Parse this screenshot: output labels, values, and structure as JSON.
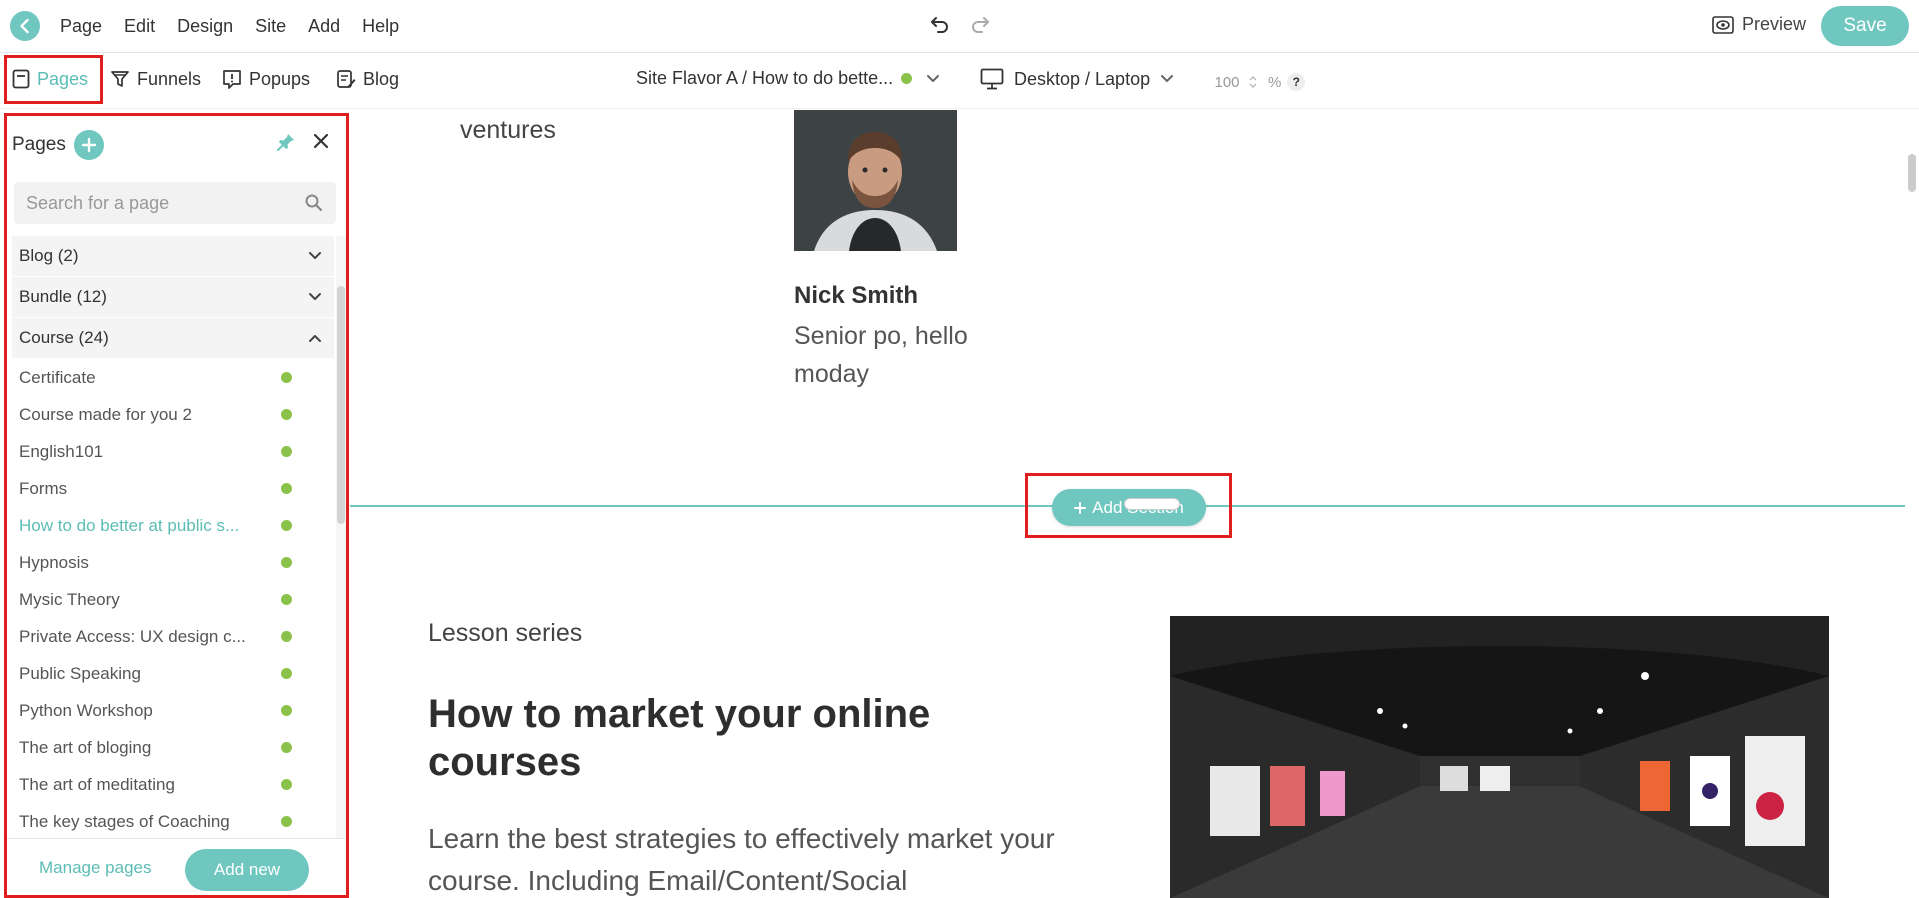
{
  "topbar": {
    "menu": [
      "Page",
      "Edit",
      "Design",
      "Site",
      "Add",
      "Help"
    ],
    "preview_label": "Preview",
    "save_label": "Save"
  },
  "toolbar": {
    "tabs": [
      "Pages",
      "Funnels",
      "Popups",
      "Blog"
    ],
    "flavor_label": "Site Flavor A / How to do bette...",
    "device_label": "Desktop / Laptop",
    "zoom_value": "100",
    "zoom_unit": "%",
    "help_label": "?"
  },
  "panel": {
    "title": "Pages",
    "search_placeholder": "Search for a page",
    "groups": [
      {
        "label": "Blog (2)",
        "expanded": false
      },
      {
        "label": "Bundle (12)",
        "expanded": false
      },
      {
        "label": "Course (24)",
        "expanded": true
      }
    ],
    "pages": [
      "Certificate",
      "Course made for you 2",
      "English101",
      "Forms",
      "How to do better at public s...",
      "Hypnosis",
      "Mysic Theory",
      "Private Access: UX design c...",
      "Public Speaking",
      "Python Workshop",
      "The art of bloging",
      "The art of meditating",
      "The key stages of Coaching"
    ],
    "active_page_index": 4,
    "status_color": "#8bc34a",
    "manage_label": "Manage pages",
    "add_new_label": "Add new"
  },
  "canvas": {
    "ventures_text": "ventures",
    "person_name": "Nick Smith",
    "person_role": "Senior po, hello moday",
    "add_section_label": "Add Section",
    "lesson_label": "Lesson series",
    "course_title": "How to market your online courses",
    "course_desc": "Learn the best strategies to effectively market your course. Including Email/Content/Social"
  },
  "colors": {
    "accent": "#6fc7c0",
    "highlight": "#e01e1e"
  }
}
